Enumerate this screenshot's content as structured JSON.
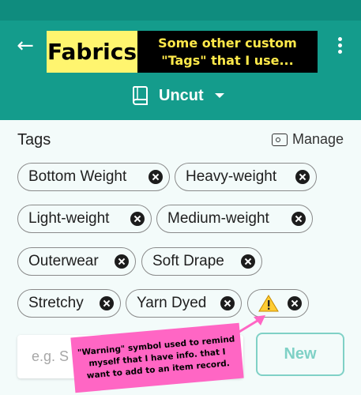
{
  "app_bar": {
    "title": "Fabrics",
    "annotation": "Some other custom \"Tags\" that I use...",
    "category": "Uncut"
  },
  "tags_section": {
    "title": "Tags",
    "manage_label": "Manage",
    "chips": [
      {
        "label": "Bottom Weight"
      },
      {
        "label": "Heavy-weight"
      },
      {
        "label": "Light-weight"
      },
      {
        "label": "Medium-weight"
      },
      {
        "label": "Outerwear"
      },
      {
        "label": "Soft Drape"
      },
      {
        "label": "Stretchy"
      },
      {
        "label": "Yarn Dyed"
      },
      {
        "label": "",
        "icon": "warning-icon"
      }
    ]
  },
  "new_tag": {
    "placeholder": "e.g. S",
    "button_label": "New"
  },
  "callout": {
    "text": "\"Warning\" symbol used to remind myself that I have info. that I want to add to an item record."
  },
  "colors": {
    "app_bar": "#149c8c",
    "highlight_yellow": "#fff56f",
    "callout_pink": "#ff66c4",
    "new_button": "#7fd1c6"
  }
}
